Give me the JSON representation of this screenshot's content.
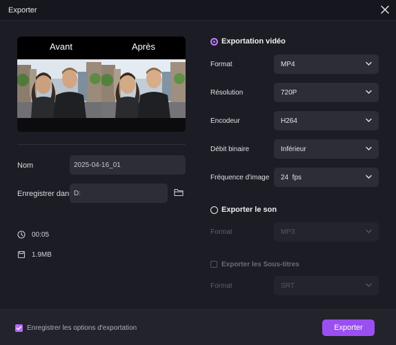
{
  "window": {
    "title": "Exporter"
  },
  "preview": {
    "before_label": "Avant",
    "after_label": "Après"
  },
  "name_field": {
    "label": "Nom",
    "value": "2025-04-16_01"
  },
  "save_field": {
    "label": "Enregistrer dans",
    "value": "D:"
  },
  "stats": {
    "duration": "00:05",
    "size": "1.9MB"
  },
  "video_export": {
    "label": "Exportation vidéo",
    "selected": true,
    "options": [
      {
        "label": "Format",
        "value": "MP4"
      },
      {
        "label": "Résolution",
        "value": "720P"
      },
      {
        "label": "Encodeur",
        "value": "H264"
      },
      {
        "label": "Débit binaire",
        "value": "Inférieur"
      },
      {
        "label": "Fréquence d'image",
        "value": "24  fps"
      }
    ]
  },
  "audio_export": {
    "label": "Exporter le son",
    "selected": false,
    "format_label": "Format",
    "format_value": "MP3"
  },
  "subtitles_export": {
    "label": "Exporter les Sous-titres",
    "checked": false,
    "format_label": "Format",
    "format_value": "SRT"
  },
  "footer": {
    "save_options_label": "Enregistrer les options d'exportation",
    "save_options_checked": true,
    "export_button": "Exporter"
  },
  "colors": {
    "accent": "#9a4ff0",
    "background": "#1b1c24",
    "field": "#2c2d36"
  }
}
